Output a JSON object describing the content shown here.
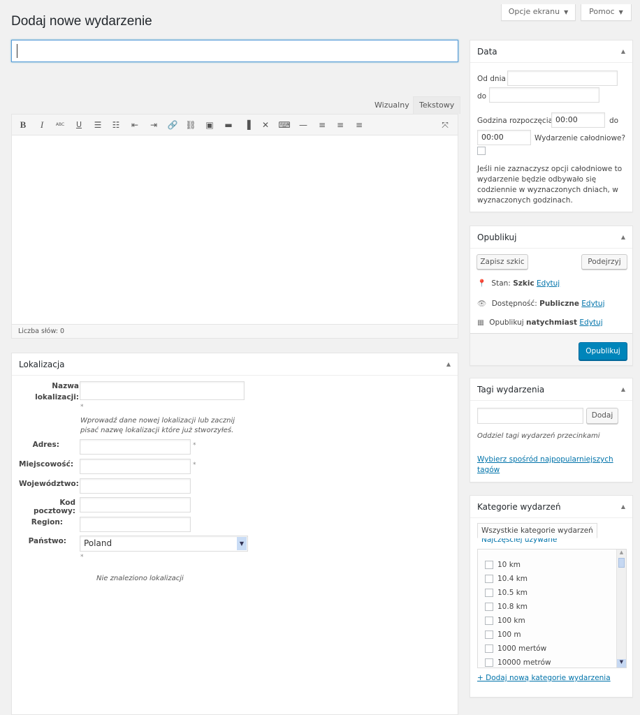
{
  "screen_options": "Opcje ekranu",
  "help": "Pomoc",
  "page_title": "Dodaj nowe wydarzenie",
  "editor": {
    "tab_visual": "Wizualny",
    "tab_text": "Tekstowy",
    "word_count": "Liczba słów: 0"
  },
  "location": {
    "title": "Lokalizacja",
    "name_label": "Nazwa lokalizacji:",
    "hint": "Wprowadź dane nowej lokalizacji lub zacznij pisać nazwę lokalizacji które już stworzyłeś.",
    "address": "Adres:",
    "town": "Miejscowość:",
    "state": "Województwo:",
    "postcode": "Kod pocztowy:",
    "region": "Region:",
    "country": "Państwo:",
    "country_value": "Poland",
    "required_mark": "*",
    "not_found": "Nie znaleziono lokalizacji"
  },
  "date": {
    "title": "Data",
    "from": "Od dnia",
    "to": "do",
    "start_time": "Godzina rozpoczęcia",
    "start_value": "00:00",
    "to2": "do",
    "end_value": "00:00",
    "all_day": "Wydarzenie całodniowe?",
    "note": "Jeśli nie zaznaczysz opcji całodniowe to wydarzenie będzie odbywało się codziennie w wyznaczonych dniach, w wyznaczonych godzinach."
  },
  "publish": {
    "title": "Opublikuj",
    "save_draft": "Zapisz szkic",
    "preview": "Podejrzyj",
    "status_label": "Stan:",
    "status_value": "Szkic",
    "visibility_label": "Dostępność:",
    "visibility_value": "Publiczne",
    "schedule_label": "Opublikuj",
    "schedule_value": "natychmiast",
    "edit": "Edytuj",
    "publish_button": "Opublikuj"
  },
  "tags": {
    "title": "Tagi wydarzenia",
    "add": "Dodaj",
    "hint": "Oddziel tagi wydarzeń przecinkami",
    "popular": "Wybierz spośród najpopularniejszych tagów"
  },
  "categories": {
    "title": "Kategorie wydarzeń",
    "tab_all": "Wszystkie kategorie wydarzeń",
    "tab_popular": "Najczęściej używane",
    "items": [
      "10 km",
      "10.4 km",
      "10.5 km",
      "10.8 km",
      "100 km",
      "100 m",
      "1000 mertów",
      "10000 metrów"
    ],
    "add_new": "+ Dodaj nową kategorie wydarzenia"
  }
}
